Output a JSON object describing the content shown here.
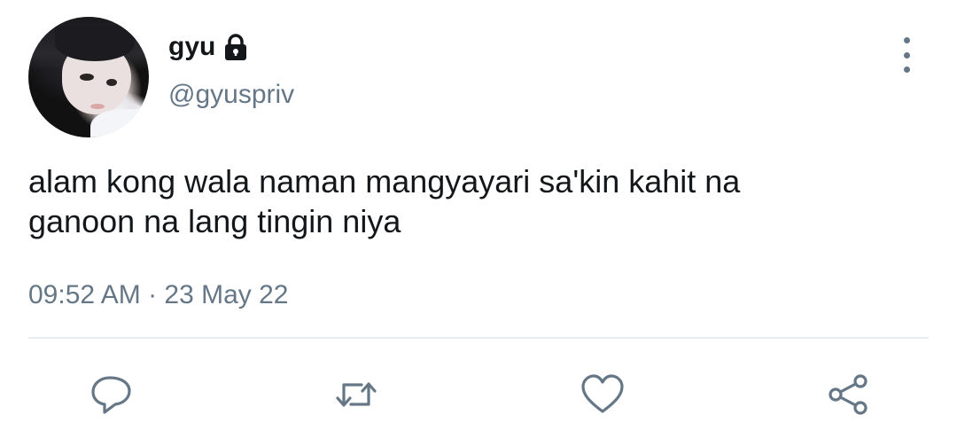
{
  "user": {
    "display_name": "gyu",
    "handle": "@gyuspriv",
    "protected_icon": "lock-icon",
    "avatar": "profile-photo"
  },
  "tweet": {
    "text_lines": [
      "alam kong wala naman mangyayari sa'kin kahit na",
      "ganoon na lang tingin niya"
    ],
    "timestamp": "09:52 AM · 23 May 22"
  },
  "actions": [
    {
      "name": "reply",
      "icon": "reply-icon"
    },
    {
      "name": "retweet",
      "icon": "retweet-icon"
    },
    {
      "name": "like",
      "icon": "heart-icon"
    },
    {
      "name": "share",
      "icon": "share-icon"
    }
  ],
  "menu_icon": "more-vertical-icon",
  "colors": {
    "text": "#14171a",
    "secondary": "#657786",
    "divider": "#e6ecf0",
    "background": "#ffffff"
  }
}
